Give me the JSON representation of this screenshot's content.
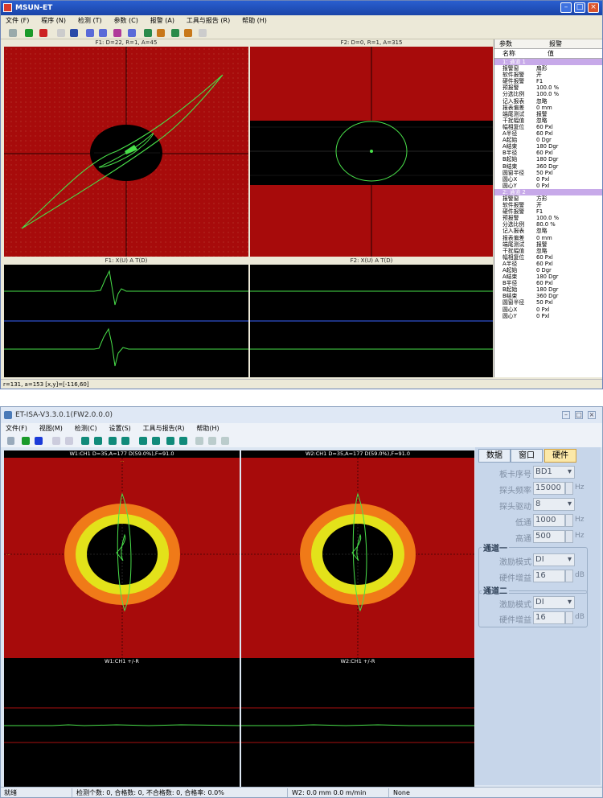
{
  "w1": {
    "title": "MSUN-ET",
    "menu": [
      "文件 (F)",
      "程序 (N)",
      "检测 (T)",
      "参数 (C)",
      "报警 (A)",
      "工具与报告 (R)",
      "帮助 (H)"
    ],
    "cap_f1": "F1: D=22, R=1, A=45",
    "cap_f2": "F2: D=0, R=1, A=315",
    "cap_f1_time": "F1: X(U) A T(D)",
    "cap_f2_time": "F2: X(U) A T(D)",
    "params_header": [
      "参数",
      "报警"
    ],
    "params_cols": [
      "名称",
      "值"
    ],
    "group1": "1: 通道 1",
    "group2": "2: 通道 2",
    "rows1": [
      [
        "报警窗",
        "扇形"
      ],
      [
        "软件报警",
        "开"
      ],
      [
        "硬件报警",
        "F1"
      ],
      [
        "预报警",
        "100.0 %"
      ],
      [
        "分选比例",
        "100.0 %"
      ],
      [
        "记入报表",
        "忽略"
      ],
      [
        "报表偏差",
        "0 mm"
      ],
      [
        "端尾测试",
        "报警"
      ],
      [
        "干扰幅值",
        "忽略"
      ],
      [
        "幅相复位",
        "60 Pxl"
      ],
      [
        "A半径",
        "60 Pxl"
      ],
      [
        "A起始",
        "0 Dgr"
      ],
      [
        "A结束",
        "180 Dgr"
      ],
      [
        "B半径",
        "60 Pxl"
      ],
      [
        "B起始",
        "180 Dgr"
      ],
      [
        "B结束",
        "360 Dgr"
      ],
      [
        "圆窗半径",
        "50 Pxl"
      ],
      [
        "圆心X",
        "0 Pxl"
      ],
      [
        "圆心Y",
        "0 Pxl"
      ]
    ],
    "rows2": [
      [
        "报警窗",
        "方形"
      ],
      [
        "软件报警",
        "开"
      ],
      [
        "硬件报警",
        "F1"
      ],
      [
        "预报警",
        "100.0 %"
      ],
      [
        "分选比例",
        "80.0 %"
      ],
      [
        "记入报表",
        "忽略"
      ],
      [
        "报表偏差",
        "0 mm"
      ],
      [
        "端尾测试",
        "报警"
      ],
      [
        "干扰幅值",
        "忽略"
      ],
      [
        "幅相复位",
        "60 Pxl"
      ],
      [
        "A半径",
        "60 Pxl"
      ],
      [
        "A起始",
        "0 Dgr"
      ],
      [
        "A结束",
        "180 Dgr"
      ],
      [
        "B半径",
        "60 Pxl"
      ],
      [
        "B起始",
        "180 Dgr"
      ],
      [
        "B结束",
        "360 Dgr"
      ],
      [
        "圆窗半径",
        "50 Pxl"
      ],
      [
        "圆心X",
        "0 Pxl"
      ],
      [
        "圆心Y",
        "0 Pxl"
      ]
    ],
    "status": "r=131, a=153 [x,y]=[-116,60]"
  },
  "w2": {
    "title": "ET-ISA-V3.3.0.1(FW2.0.0.0)",
    "menu": [
      "文件(F)",
      "视图(M)",
      "检测(C)",
      "设置(S)",
      "工具与报告(R)",
      "帮助(H)"
    ],
    "cap_w1": "W1:CH1 D=35,A=177 D(59.0%),F=91.0",
    "cap_w2": "W2:CH1 D=35,A=177 D(59.0%),F=91.0",
    "cap_w1_time": "W1:CH1 +/-R",
    "cap_w2_time": "W2:CH1 +/-R",
    "tabs": [
      "数据",
      "窗口",
      "硬件"
    ],
    "fields": [
      {
        "label": "板卡序号",
        "value": "BD1",
        "unit": ""
      },
      {
        "label": "探头频率",
        "value": "15000",
        "unit": "Hz"
      },
      {
        "label": "探头驱动",
        "value": "8",
        "unit": ""
      },
      {
        "label": "低通",
        "value": "1000",
        "unit": "Hz"
      },
      {
        "label": "高通",
        "value": "500",
        "unit": "Hz"
      }
    ],
    "group1": {
      "title": "通道一",
      "mode_label": "激励模式",
      "mode": "DI",
      "gain_label": "硬件增益",
      "gain": "16",
      "unit": "dB"
    },
    "group2": {
      "title": "通道二",
      "mode_label": "激励模式",
      "mode": "DI",
      "gain_label": "硬件增益",
      "gain": "16",
      "unit": "dB"
    },
    "status": {
      "ready": "就绪",
      "counts": "检测个数: 0, 合格数: 0, 不合格数: 0, 合格率: 0.0%",
      "speed": "W2: 0.0 mm  0.0 m/min",
      "none": "None"
    }
  }
}
